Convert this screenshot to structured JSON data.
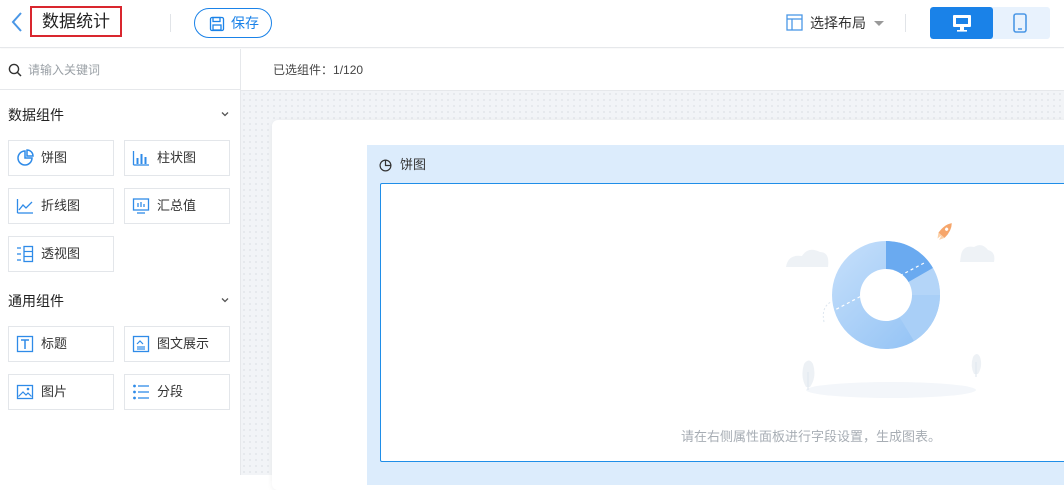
{
  "header": {
    "title": "数据统计",
    "save_label": "保存",
    "layout_label": "选择布局",
    "device_desktop": "desktop-icon",
    "device_mobile": "mobile-icon"
  },
  "sidebar": {
    "search_placeholder": "请输入关键词",
    "sections": [
      {
        "title": "数据组件",
        "items": [
          {
            "label": "饼图",
            "icon": "pie-chart-icon"
          },
          {
            "label": "柱状图",
            "icon": "bar-chart-icon"
          },
          {
            "label": "折线图",
            "icon": "line-chart-icon"
          },
          {
            "label": "汇总值",
            "icon": "summary-icon"
          },
          {
            "label": "透视图",
            "icon": "pivot-icon"
          }
        ]
      },
      {
        "title": "通用组件",
        "items": [
          {
            "label": "标题",
            "icon": "title-icon"
          },
          {
            "label": "图文展示",
            "icon": "image-text-icon"
          },
          {
            "label": "图片",
            "icon": "image-icon"
          },
          {
            "label": "分段",
            "icon": "segment-icon"
          }
        ]
      }
    ]
  },
  "main": {
    "selected_label": "已选组件：",
    "selected_count": "1/120",
    "card_title": "饼图",
    "empty_hint": "请在右侧属性面板进行字段设置，生成图表。"
  },
  "colors": {
    "accent": "#1a82e8",
    "highlight_border": "#d9262e",
    "card_bg": "#dcecfc"
  }
}
